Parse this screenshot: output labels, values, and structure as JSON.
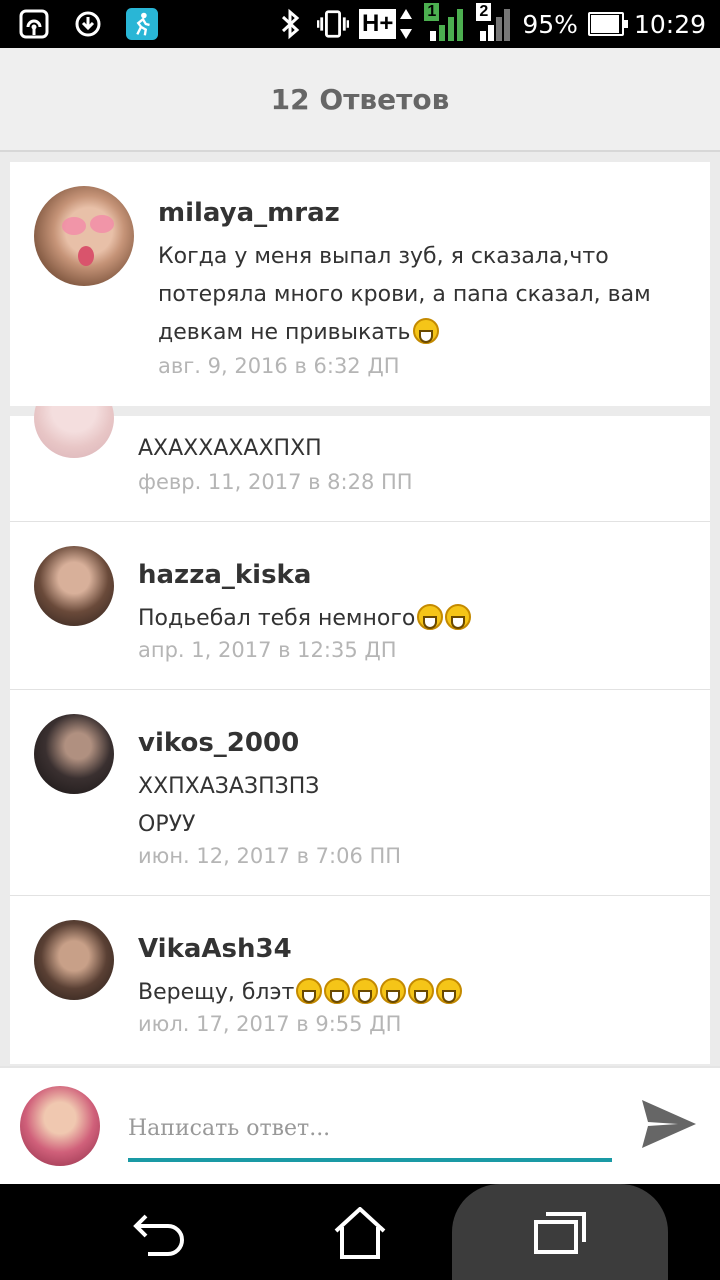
{
  "status_bar": {
    "network_label": "H+",
    "sim1": "1",
    "sim2": "2",
    "battery_percent": "95%",
    "battery_level": 0.95,
    "time": "10:29",
    "icons": [
      "hotspot-icon",
      "sync-icon",
      "fitness-app-icon",
      "bluetooth-icon",
      "vibrate-icon",
      "signal-icon",
      "battery-icon"
    ]
  },
  "header": {
    "title": "12 Ответов"
  },
  "pinned_comment": {
    "username": "milaya_mraz",
    "text": "Когда у меня выпал зуб, я сказала,что потеряла много крови, а папа сказал, вам девкам не привыкать",
    "emoji_count": 1,
    "time": "авг. 9, 2016 в 6:32 ДП"
  },
  "comments": [
    {
      "username": "",
      "text": "АХАХХАХАХПХП",
      "emoji_count": 0,
      "time": "февр. 11, 2017 в 8:28 ПП"
    },
    {
      "username": "hazza_kiska",
      "text": "Подьебал тебя немного",
      "emoji_count": 2,
      "time": "апр. 1, 2017 в 12:35 ДП"
    },
    {
      "username": "vikos_2000",
      "text_lines": [
        "ХХПХАЗАЗПЗПЗ",
        "ОРУУ"
      ],
      "emoji_count": 0,
      "time": "июн. 12, 2017 в 7:06 ПП"
    },
    {
      "username": "VikaAsh34",
      "text": "Верещу, блэт",
      "emoji_count": 6,
      "time": "июл. 17, 2017 в 9:55 ДП"
    }
  ],
  "reply": {
    "placeholder": "Написать ответ..."
  },
  "colors": {
    "accent": "#1a9aa5",
    "username": "#333333",
    "timestamp": "#b5b5b5",
    "header_title": "#666666"
  }
}
